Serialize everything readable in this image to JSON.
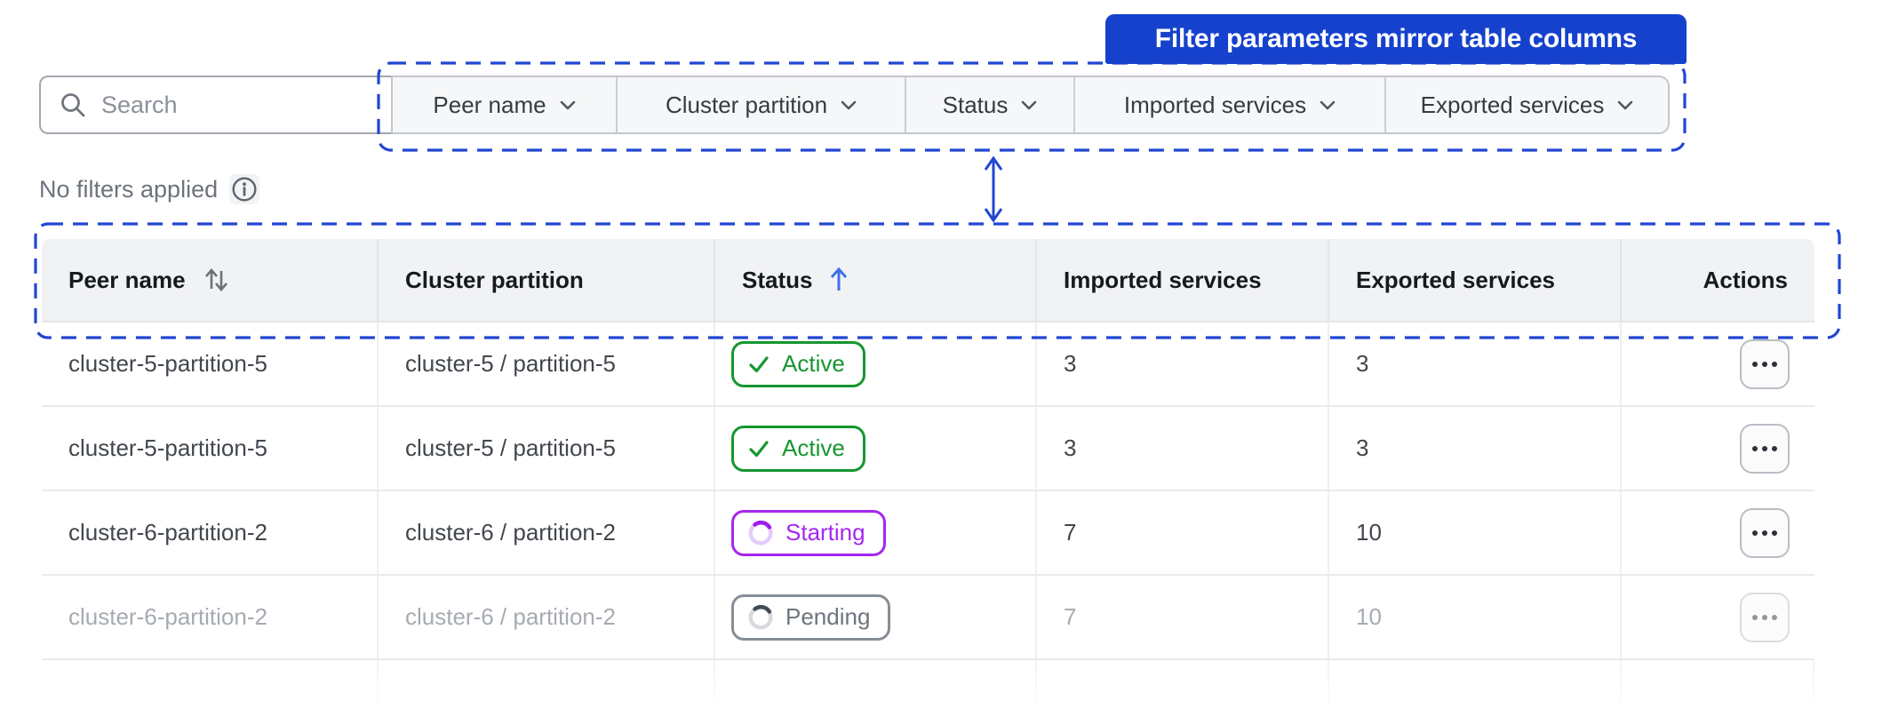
{
  "callout": {
    "text": "Filter parameters mirror table columns"
  },
  "filter_bar": {
    "search_placeholder": "Search",
    "search_icon": "magnifier-icon",
    "dropdowns": [
      {
        "label": "Peer name",
        "icon": "chevron-down-icon"
      },
      {
        "label": "Cluster partition",
        "icon": "chevron-down-icon"
      },
      {
        "label": "Status",
        "icon": "chevron-down-icon"
      },
      {
        "label": "Imported services",
        "icon": "chevron-down-icon"
      },
      {
        "label": "Exported services",
        "icon": "chevron-down-icon"
      }
    ]
  },
  "filters_status": {
    "text": "No filters applied",
    "icon": "info-circle-icon"
  },
  "annotations": {
    "arrow_icon": "double-headed-arrow-icon"
  },
  "table": {
    "columns": [
      {
        "label": "Peer name",
        "sort": "both",
        "sort_icon": "sort-both-icon"
      },
      {
        "label": "Cluster partition",
        "sort": "none"
      },
      {
        "label": "Status",
        "sort": "asc",
        "sort_icon": "sort-ascending-icon"
      },
      {
        "label": "Imported services",
        "sort": "none"
      },
      {
        "label": "Exported services",
        "sort": "none"
      },
      {
        "label": "Actions",
        "sort": "none"
      }
    ],
    "rows": [
      {
        "peer_name": "cluster-5-partition-5",
        "cluster_partition": "cluster-5 / partition-5",
        "status": {
          "label": "Active",
          "variant": "active",
          "icon": "check-icon"
        },
        "imported_services": "3",
        "exported_services": "3",
        "faded": false,
        "actions_icon": "ellipsis-icon"
      },
      {
        "peer_name": "cluster-5-partition-5",
        "cluster_partition": "cluster-5 / partition-5",
        "status": {
          "label": "Active",
          "variant": "active",
          "icon": "check-icon"
        },
        "imported_services": "3",
        "exported_services": "3",
        "faded": false,
        "actions_icon": "ellipsis-icon"
      },
      {
        "peer_name": "cluster-6-partition-2",
        "cluster_partition": "cluster-6 / partition-2",
        "status": {
          "label": "Starting",
          "variant": "starting",
          "icon": "spinner-icon"
        },
        "imported_services": "7",
        "exported_services": "10",
        "faded": false,
        "actions_icon": "ellipsis-icon"
      },
      {
        "peer_name": "cluster-6-partition-2",
        "cluster_partition": "cluster-6 / partition-2",
        "status": {
          "label": "Pending",
          "variant": "pending",
          "icon": "spinner-icon"
        },
        "imported_services": "7",
        "exported_services": "10",
        "faded": true,
        "actions_icon": "ellipsis-icon"
      }
    ]
  },
  "colors": {
    "banner_blue": "#1541cd",
    "dashed_blue": "#2146d2",
    "sort_arrow_blue": "#4170e8",
    "status_green": "#169630",
    "status_purple": "#a527f0",
    "status_gray": "#878d95"
  }
}
